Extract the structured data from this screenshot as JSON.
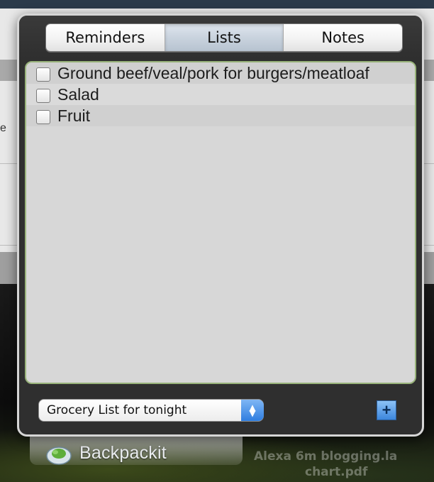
{
  "tabs": [
    {
      "label": "Reminders",
      "active": false
    },
    {
      "label": "Lists",
      "active": true
    },
    {
      "label": "Notes",
      "active": false
    }
  ],
  "list": {
    "items": [
      {
        "text": "Ground beef/veal/pork for burgers/meatloaf",
        "checked": false
      },
      {
        "text": "Salad",
        "checked": false
      },
      {
        "text": "Fruit",
        "checked": false
      }
    ]
  },
  "footer": {
    "list_select_value": "Grocery List for tonight",
    "add_label": "+"
  },
  "dock": {
    "app_name": "Backpackit",
    "file_line1": "Alexa 6m blogging.la",
    "file_line2": "chart.pdf"
  },
  "background": {
    "side_text": "e"
  },
  "colors": {
    "panel": "#2f2f2f",
    "list_border": "#98b37a",
    "accent_blue": "#3c86dd"
  },
  "icons": {
    "dock_logo": "backpack-cloud-icon",
    "select_arrows": "up-down-arrows-icon",
    "add": "plus-icon"
  }
}
